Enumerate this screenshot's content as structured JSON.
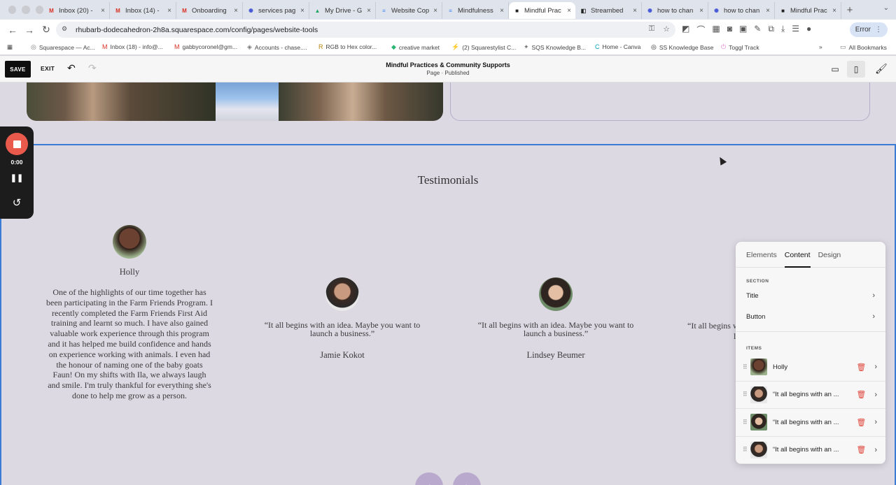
{
  "browser": {
    "tabs": [
      {
        "label": "Inbox (20) -",
        "icon": "M",
        "color": "#d93025"
      },
      {
        "label": "Inbox (14) -",
        "icon": "M",
        "color": "#d93025"
      },
      {
        "label": "Onboarding",
        "icon": "M",
        "color": "#d93025"
      },
      {
        "label": "services pag",
        "icon": "✺",
        "color": "#4a5bd8"
      },
      {
        "label": "My Drive - G",
        "icon": "▲",
        "color": "#1fa463"
      },
      {
        "label": "Website Cop",
        "icon": "≡",
        "color": "#4285f4"
      },
      {
        "label": "Mindfulness",
        "icon": "≡",
        "color": "#4285f4"
      },
      {
        "label": "Mindful Prac",
        "icon": "■",
        "color": "#222"
      },
      {
        "label": "Streambed",
        "icon": "◧",
        "color": "#222"
      },
      {
        "label": "how to chan",
        "icon": "✺",
        "color": "#4a5bd8"
      },
      {
        "label": "how to chan",
        "icon": "✺",
        "color": "#4a5bd8"
      },
      {
        "label": "Mindful Prac",
        "icon": "■",
        "color": "#222"
      }
    ],
    "url": "rhubarb-dodecahedron-2h8a.squarespace.com/config/pages/website-tools",
    "error_label": "Error",
    "bookmarks": [
      "Squarespace — Ac...",
      "Inbox (18) - info@...",
      "gabbycoronel@gm...",
      "Accounts - chase....",
      "RGB to Hex color...",
      "creative market",
      "(2) Squarestylist C...",
      "SQS Knowledge B...",
      "Home - Canva",
      "SS Knowledge Base",
      "Toggl Track"
    ],
    "all_bookmarks": "All Bookmarks"
  },
  "toolbar": {
    "save_label": "SAVE",
    "exit_label": "EXIT",
    "page_title": "Mindful Practices & Community Supports",
    "page_status": "Page · Published"
  },
  "recorder": {
    "time": "0:00"
  },
  "section": {
    "title": "Testimonials"
  },
  "testimonials": [
    {
      "name": "Holly",
      "quote": "One of the highlights of our time together has been participating in the Farm Friends Program. I recently completed the Farm Friends First Aid training and learnt so much. I have also gained valuable work experience through this program and it has helped me build confidence and hands on experience working with animals. I even had the honour of naming one of the baby goats Faun! On my shifts with Ila, we always laugh and  smile. I'm truly thankful for everything she's done to help me grow as a person."
    },
    {
      "name": "Jamie Kokot",
      "quote": "“It all begins with an idea. Maybe you want to launch a business.”"
    },
    {
      "name": "Lindsey Beumer",
      "quote": "“It all begins with an idea. Maybe you want to launch a business.”"
    },
    {
      "name": "",
      "quote": "“It all begins w"
    }
  ],
  "panel": {
    "tabs": [
      "Elements",
      "Content",
      "Design"
    ],
    "section_label": "SECTION",
    "section_rows": [
      "Title",
      "Button"
    ],
    "items_label": "ITEMS",
    "items": [
      "Holly",
      "“It all begins with an ...",
      "“It all begins with an ...",
      "“It all begins with an ..."
    ]
  },
  "colors": {
    "accent_blue": "#3a7bd5",
    "canvas_bg": "#ddd9e3",
    "record_red": "#ea5a4c",
    "trash_red": "#e0463c"
  }
}
